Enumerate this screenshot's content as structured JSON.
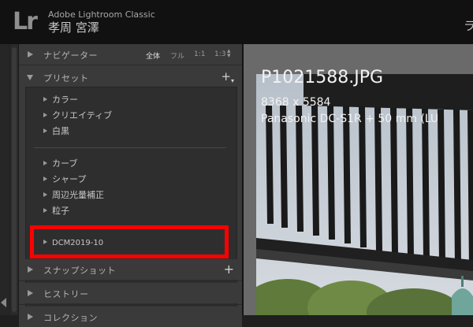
{
  "app": {
    "logo": "Lr",
    "name": "Adobe Lightroom Classic",
    "user": "孝周 宮澤",
    "module_peek": "ラ"
  },
  "navigator": {
    "title": "ナビゲーター",
    "zoom": [
      "全体",
      "フル",
      "1:1",
      "1:3"
    ]
  },
  "presets": {
    "title": "プリセット",
    "group1": [
      "カラー",
      "クリエイティブ",
      "白黒"
    ],
    "group2": [
      "カーブ",
      "シャープ",
      "周辺光量補正",
      "粒子"
    ],
    "user_preset": "DCM2019-10"
  },
  "snapshots": {
    "title": "スナップショット"
  },
  "history": {
    "title": "ヒストリー"
  },
  "collections": {
    "title": "コレクション"
  },
  "photo_info": {
    "filename": "P1021588.JPG",
    "dimensions": "8368 x 5584",
    "camera": "Panasonic DC-S1R + 50 mm (LU"
  },
  "colors": {
    "highlight": "#ff0000",
    "panel": "#3a3a3a",
    "titlebar": "#111111"
  }
}
